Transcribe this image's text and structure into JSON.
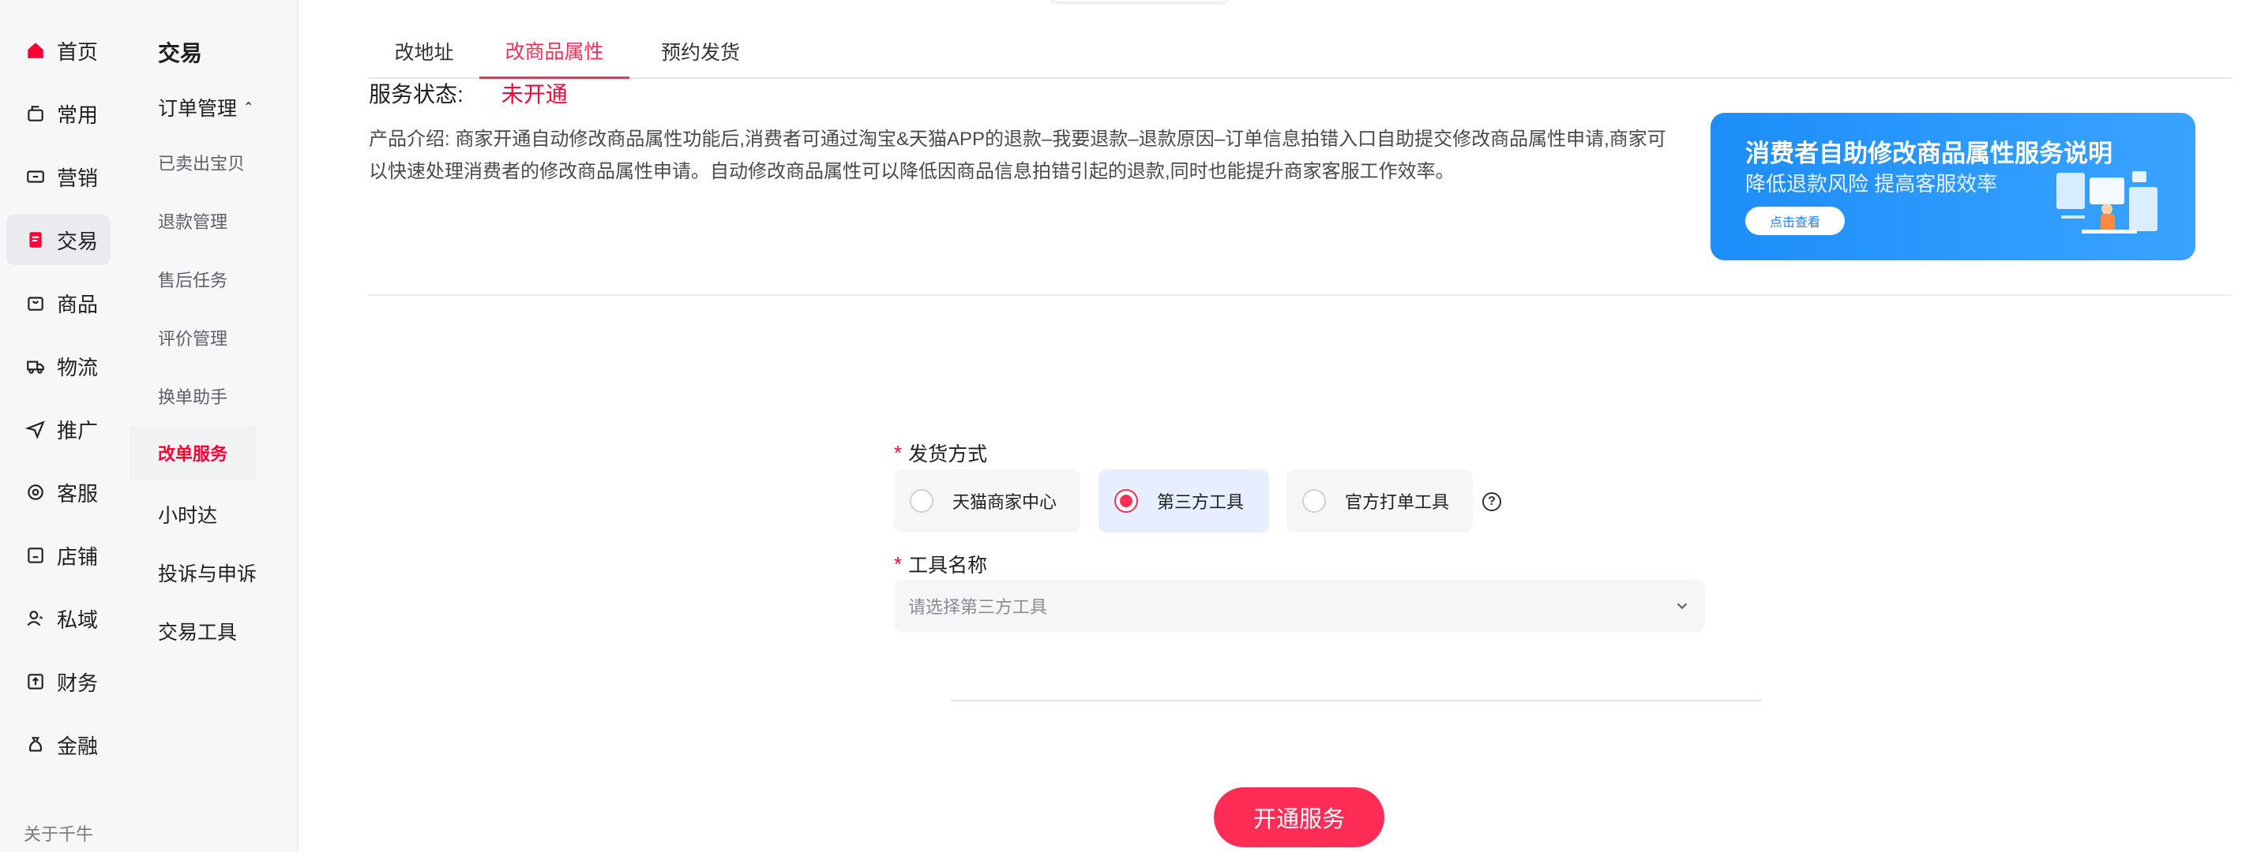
{
  "rail": {
    "items": [
      {
        "label": "首页",
        "icon": "home-icon"
      },
      {
        "label": "常用",
        "icon": "star-box-icon"
      },
      {
        "label": "营销",
        "icon": "ticket-icon"
      },
      {
        "label": "交易",
        "icon": "order-icon"
      },
      {
        "label": "商品",
        "icon": "bag-icon"
      },
      {
        "label": "物流",
        "icon": "truck-icon"
      },
      {
        "label": "推广",
        "icon": "send-icon"
      },
      {
        "label": "客服",
        "icon": "headset-icon"
      },
      {
        "label": "店铺",
        "icon": "store-icon"
      },
      {
        "label": "私域",
        "icon": "users-icon"
      },
      {
        "label": "财务",
        "icon": "finance-icon"
      },
      {
        "label": "金融",
        "icon": "money-bag-icon"
      }
    ],
    "footer": "关于千牛"
  },
  "subnav": {
    "title": "交易",
    "group": "订单管理",
    "sub_items": [
      "已卖出宝贝",
      "退款管理",
      "售后任务",
      "评价管理",
      "换单助手",
      "改单服务"
    ],
    "top_items": [
      "小时达",
      "投诉与申诉",
      "交易工具"
    ]
  },
  "tabs": [
    "改地址",
    "改商品属性",
    "预约发货"
  ],
  "status": {
    "label": "服务状态:",
    "value": "未开通"
  },
  "intro": "产品介绍:  商家开通自动修改商品属性功能后,消费者可通过淘宝&天猫APP的退款–我要退款–退款原因–订单信息拍错入口自助提交修改商品属性申请,商家可以快速处理消费者的修改商品属性申请。自动修改商品属性可以降低因商品信息拍错引起的退款,同时也能提升商家客服工作效率。",
  "banner": {
    "title": "消费者自助修改商品属性服务说明",
    "subtitle": "降低退款风险   提高客服效率",
    "button": "点击查看"
  },
  "form": {
    "ship_label": "发货方式",
    "ship_options": [
      "天猫商家中心",
      "第三方工具",
      "官方打单工具"
    ],
    "selected_option": "第三方工具",
    "tool_label": "工具名称",
    "tool_placeholder": "请选择第三方工具"
  },
  "cta": "开通服务",
  "colors": {
    "accent": "#ff2d55",
    "status": "#ff0036",
    "banner": "#1d8df8"
  }
}
